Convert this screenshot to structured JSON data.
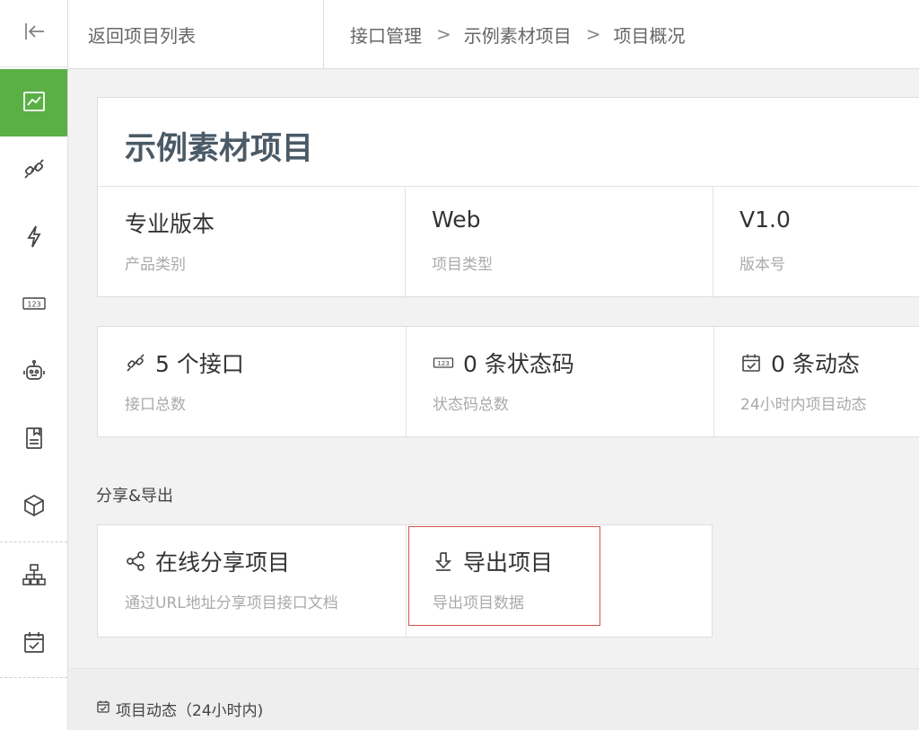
{
  "sidebar": {
    "collapse_icon": "collapse-left-icon",
    "items": [
      {
        "icon": "chart-icon",
        "active": true
      },
      {
        "icon": "link-icon",
        "active": false
      },
      {
        "icon": "lightning-icon",
        "active": false
      },
      {
        "icon": "code-123-icon",
        "active": false
      },
      {
        "icon": "robot-icon",
        "active": false
      },
      {
        "icon": "document-icon",
        "active": false
      },
      {
        "icon": "box-icon",
        "active": false
      },
      {
        "icon": "sitemap-icon",
        "active": false
      },
      {
        "icon": "calendar-check-icon",
        "active": false
      }
    ],
    "accent_color": "#5ab045"
  },
  "header": {
    "back_label": "返回项目列表",
    "breadcrumb": [
      "接口管理",
      "示例素材项目",
      "项目概况"
    ],
    "separator": ">"
  },
  "project": {
    "title": "示例素材项目",
    "info": [
      {
        "value": "专业版本",
        "label": "产品类别"
      },
      {
        "value": "Web",
        "label": "项目类型"
      },
      {
        "value": "V1.0",
        "label": "版本号"
      }
    ]
  },
  "stats": [
    {
      "icon": "link-icon",
      "value": "5 个接口",
      "label": "接口总数"
    },
    {
      "icon": "code-123-icon",
      "value": "0 条状态码",
      "label": "状态码总数"
    },
    {
      "icon": "calendar-check-icon",
      "value": "0 条动态",
      "label": "24小时内项目动态"
    }
  ],
  "share_section": {
    "title": "分享&导出",
    "items": [
      {
        "icon": "share-icon",
        "title": "在线分享项目",
        "desc": "通过URL地址分享项目接口文档"
      },
      {
        "icon": "download-icon",
        "title": "导出项目",
        "desc": "导出项目数据"
      }
    ],
    "highlight_color": "#d9534f"
  },
  "activity": {
    "title": "项目动态（24小时内)"
  }
}
